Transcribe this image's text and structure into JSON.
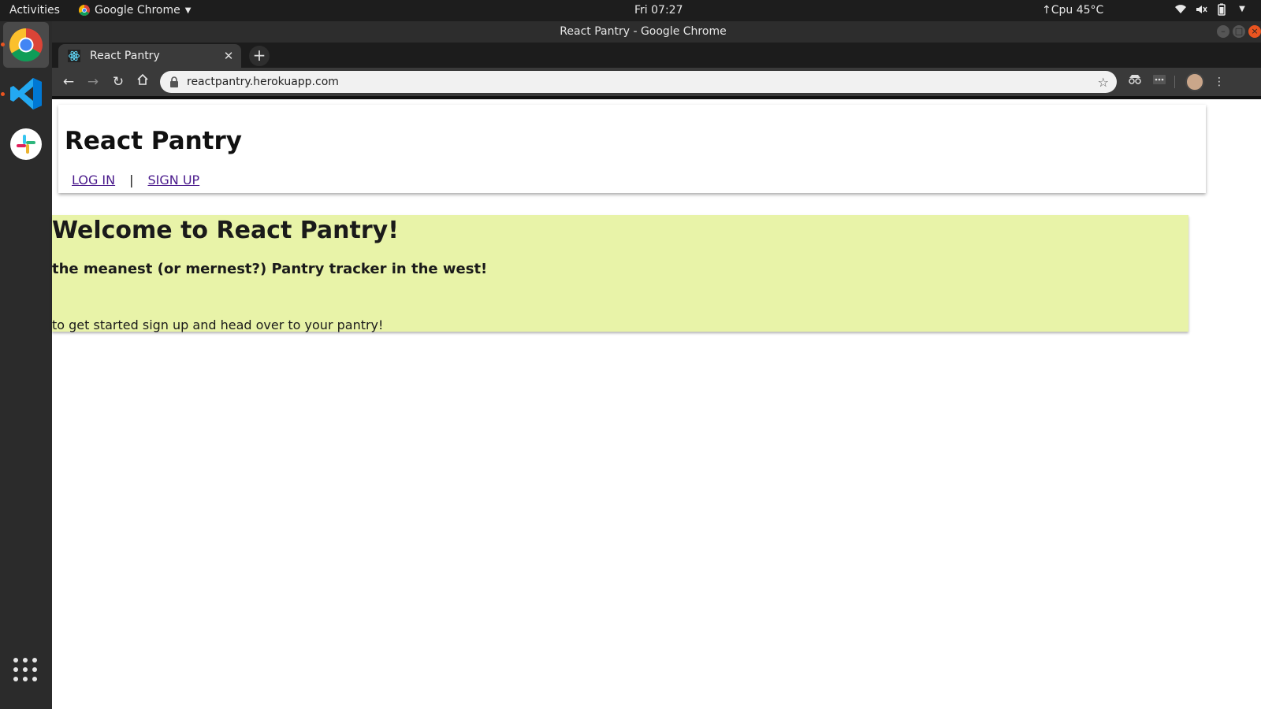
{
  "os": {
    "activities": "Activities",
    "app_menu": "Google Chrome",
    "clock": "Fri 07:27",
    "cpu": "↑Cpu 45°C"
  },
  "window": {
    "title": "React Pantry - Google Chrome"
  },
  "browser": {
    "tab_title": "React Pantry",
    "url": "reactpantry.herokuapp.com"
  },
  "header": {
    "title": "React Pantry",
    "login": "LOG IN",
    "separator": "|",
    "signup": "SIGN UP"
  },
  "welcome": {
    "heading": "Welcome to React Pantry!",
    "subheading": "the meanest (or mernest?) Pantry tracker in the west!",
    "body": "to get started sign up and head over to your pantry!"
  },
  "colors": {
    "welcome_bg": "#e8f3a8",
    "link": "#4a1a8c",
    "ubuntu_accent": "#e95420"
  }
}
